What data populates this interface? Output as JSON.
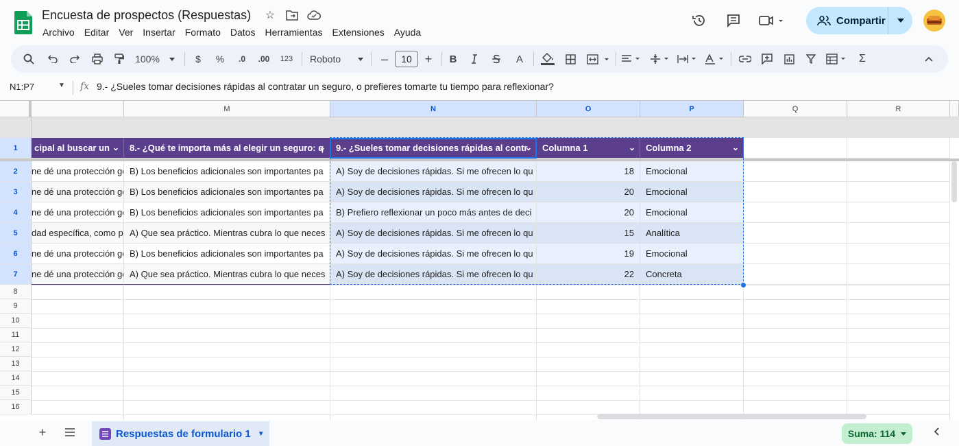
{
  "title": "Encuesta de prospectos (Respuestas)",
  "menu": [
    "Archivo",
    "Editar",
    "Ver",
    "Insertar",
    "Formato",
    "Datos",
    "Herramientas",
    "Extensiones",
    "Ayuda"
  ],
  "share_label": "Compartir",
  "toolbar": {
    "zoom": "100%",
    "currency": "$",
    "percent": "%",
    "dec_decrease": ".0",
    "dec_increase": ".00",
    "format_more": "123",
    "font": "Roboto",
    "font_size": "10",
    "bold": "B",
    "text_color": "A"
  },
  "formula_bar": {
    "name_box": "N1:P7",
    "fx": "fx",
    "content": "9.-  ¿Sueles tomar decisiones rápidas al contratar un seguro, o prefieres tomarte tu tiempo para reflexionar?"
  },
  "columns": [
    "M",
    "N",
    "O",
    "P",
    "Q",
    "R"
  ],
  "rows": [
    "1",
    "2",
    "3",
    "4",
    "5",
    "6",
    "7",
    "8",
    "9",
    "10",
    "11",
    "12",
    "13",
    "14",
    "15",
    "16"
  ],
  "headers": {
    "l": "cipal al buscar un",
    "m": "8.- ¿Qué te importa más al elegir un seguro: q",
    "n": "9.- ¿Sueles tomar decisiones rápidas al contr",
    "o": "Columna 1",
    "p": "Columna 2"
  },
  "data_rows": [
    {
      "l": "ne dé una protección ge",
      "m": "B) Los beneficios adicionales son importantes pa",
      "n": "A) Soy de decisiones rápidas. Si me ofrecen lo qu",
      "o": "18",
      "p": "Emocional"
    },
    {
      "l": "ne dé una protección ge",
      "m": "B) Los beneficios adicionales son importantes pa",
      "n": "A) Soy de decisiones rápidas. Si me ofrecen lo qu",
      "o": "20",
      "p": "Emocional"
    },
    {
      "l": "ne dé una protección ge",
      "m": "B) Los beneficios adicionales son importantes pa",
      "n": "B) Prefiero reflexionar un poco más antes de deci",
      "o": "20",
      "p": "Emocional"
    },
    {
      "l": "dad específica, como p",
      "m": "A) Que sea práctico. Mientras cubra lo que neces",
      "n": "A) Soy de decisiones rápidas. Si me ofrecen lo qu",
      "o": "15",
      "p": "Analítica"
    },
    {
      "l": "ne dé una protección ge",
      "m": "B) Los beneficios adicionales son importantes pa",
      "n": "A) Soy de decisiones rápidas. Si me ofrecen lo qu",
      "o": "19",
      "p": "Emocional"
    },
    {
      "l": "ne dé una protección ge",
      "m": "A) Que sea práctico. Mientras cubra lo que neces",
      "n": "A) Soy de decisiones rápidas. Si me ofrecen lo qu",
      "o": "22",
      "p": "Concreta"
    }
  ],
  "sheet_tab": "Respuestas de formulario 1",
  "sum": "Suma: 114",
  "colors": {
    "header_fill": "#5b3f8c",
    "band_light": "#e8f0fe",
    "band_dark": "#d9e4f5",
    "selection": "#1a73e8",
    "share_bg": "#c2e7ff",
    "sum_bg": "#c4eed0"
  }
}
